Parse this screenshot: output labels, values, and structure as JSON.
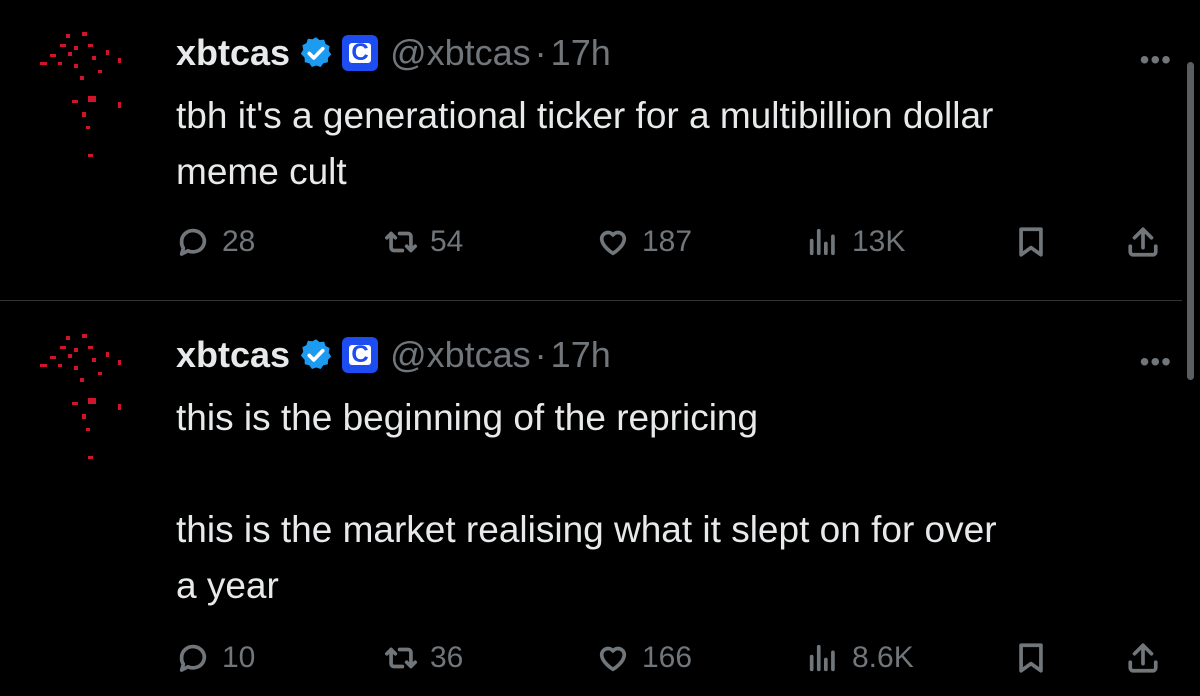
{
  "tweets": [
    {
      "name": "xbtcas",
      "handle": "@xbtcas",
      "separator": "·",
      "time": "17h",
      "affiliate_letter": "C",
      "more": "•••",
      "text_lines": [
        "tbh it's a generational ticker for a multibillion dollar",
        "meme cult"
      ],
      "stats": {
        "replies": "28",
        "reposts": "54",
        "likes": "187",
        "views": "13K"
      }
    },
    {
      "name": "xbtcas",
      "handle": "@xbtcas",
      "separator": "·",
      "time": "17h",
      "affiliate_letter": "C",
      "more": "•••",
      "text_lines": [
        "this is the beginning of the repricing",
        "",
        "this is the market realising what it slept on for over",
        "a year"
      ],
      "stats": {
        "replies": "10",
        "reposts": "36",
        "likes": "166",
        "views": "8.6K"
      }
    }
  ],
  "icons": {
    "verified": "verified-badge-icon",
    "affiliate": "affiliate-badge-icon",
    "reply": "reply-icon",
    "repost": "repost-icon",
    "like": "heart-icon",
    "views": "views-icon",
    "bookmark": "bookmark-icon",
    "share": "share-icon"
  },
  "colors": {
    "background": "#000000",
    "text": "#e7e9ea",
    "muted": "#71767b",
    "verified": "#1d9bf0",
    "affiliate": "#1d4cf0",
    "avatar_accent": "#d0142a"
  }
}
